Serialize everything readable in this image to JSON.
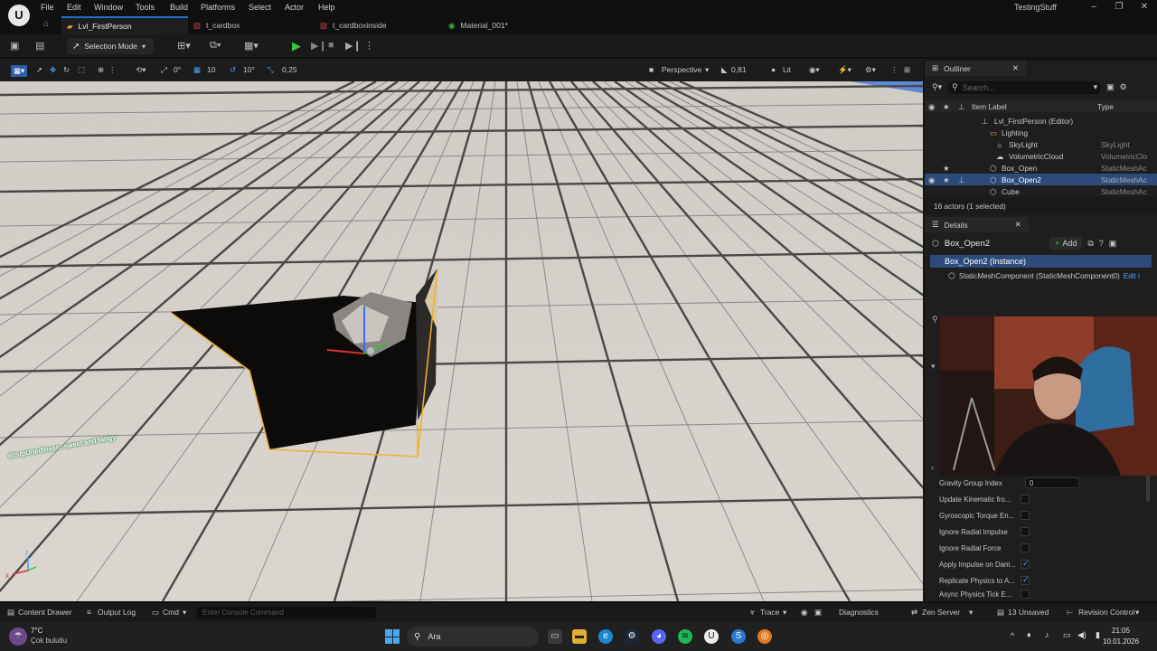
{
  "menu": [
    "File",
    "Edit",
    "Window",
    "Tools",
    "Build",
    "Platforms",
    "Select",
    "Actor",
    "Help"
  ],
  "project_name": "TestingStuff",
  "tabs": [
    {
      "label": "Lvl_FirstPerson",
      "active": true
    },
    {
      "label": "t_cardbox",
      "active": false
    },
    {
      "label": "t_cardboxinside",
      "active": false
    },
    {
      "label": "Material_001*",
      "active": false
    }
  ],
  "toolbar": {
    "mode_label": "Selection Mode"
  },
  "viewport_toolbar": {
    "translate_snap": "0°",
    "grid_snap": "10",
    "rotation_snap": "10°",
    "scale_snap": "0,25",
    "perspective_label": "Perspective",
    "camera_speed": "0,81",
    "lit_label": "Lit"
  },
  "overlay_text": "d0stpUnedInsan: sweet and tangy",
  "outliner": {
    "title": "Outliner",
    "search_placeholder": "Search...",
    "col_label": "Item Label",
    "col_type": "Type",
    "rows": [
      {
        "label": "Lvl_FirstPerson (Editor)",
        "type": ""
      },
      {
        "label": "Lighting",
        "type": ""
      },
      {
        "label": "SkyLight",
        "type": "SkyLight"
      },
      {
        "label": "VolumetricCloud",
        "type": "VolumetricClo"
      },
      {
        "label": "Box_Open",
        "type": "StaticMeshAc"
      },
      {
        "label": "Box_Open2",
        "type": "StaticMeshAc"
      },
      {
        "label": "Cube",
        "type": "StaticMeshAc"
      }
    ],
    "status": "16 actors (1 selected)"
  },
  "details": {
    "title": "Details",
    "actor_name": "Box_Open2",
    "add_label": "Add",
    "instance_label": "Box_Open2 (Instance)",
    "component_label": "StaticMeshComponent (StaticMeshComponent0)",
    "edit_label": "Edit i",
    "properties": [
      {
        "label": "Gravity Group Index",
        "value": "0",
        "checked": null
      },
      {
        "label": "Update Kinematic fro...",
        "value": null,
        "checked": false
      },
      {
        "label": "Gyroscopic Torque En...",
        "value": null,
        "checked": false
      },
      {
        "label": "Ignore Radial Impulse",
        "value": null,
        "checked": false
      },
      {
        "label": "Ignore Radial Force",
        "value": null,
        "checked": false
      },
      {
        "label": "Apply Impulse on Dam...",
        "value": null,
        "checked": true
      },
      {
        "label": "Replicate Physics to A...",
        "value": null,
        "checked": true
      },
      {
        "label": "Async Physics Tick E...",
        "value": null,
        "checked": false
      }
    ]
  },
  "bottombar": {
    "content_drawer": "Content Drawer",
    "output_log": "Output Log",
    "cmd": "Cmd",
    "console_placeholder": "Enter Console Command",
    "trace": "Trace",
    "diagnostics": "Diagnostics",
    "zen_server": "Zen Server",
    "unsaved": "13 Unsaved",
    "revision_control": "Revision Control"
  },
  "taskbar": {
    "temperature": "7°C",
    "weather": "Çok bulutlu",
    "search_label": "Ara",
    "time": "21:05",
    "date": "10.01.2026"
  },
  "colors": {
    "accent": "#1e6fd0",
    "selection": "#2c4a7a",
    "select_outline": "#f0b030"
  }
}
